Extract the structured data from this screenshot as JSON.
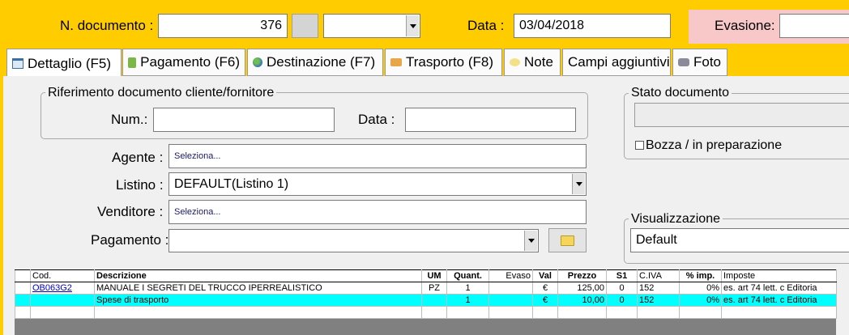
{
  "header": {
    "doc_number_label": "N. documento :",
    "doc_number_value": "376",
    "date_label": "Data :",
    "date_value": "03/04/2018",
    "evasione_label": "Evasione:"
  },
  "tabs": [
    {
      "label": "Dettaglio (F5)",
      "icon": "calendar-icon"
    },
    {
      "label": "Pagamento (F6)",
      "icon": "payment-icon"
    },
    {
      "label": "Destinazione (F7)",
      "icon": "globe-icon"
    },
    {
      "label": "Trasporto (F8)",
      "icon": "truck-icon"
    },
    {
      "label": "Note",
      "icon": "note-icon"
    },
    {
      "label": "Campi aggiuntivi",
      "icon": ""
    },
    {
      "label": "Foto",
      "icon": "camera-icon"
    }
  ],
  "riferimento": {
    "title": "Riferimento documento cliente/fornitore",
    "num_label": "Num.:",
    "data_label": "Data :"
  },
  "form": {
    "agente_label": "Agente :",
    "agente_value": "Seleziona...",
    "listino_label": "Listino :",
    "listino_value": "DEFAULT(Listino 1)",
    "venditore_label": "Venditore :",
    "venditore_value": "Seleziona...",
    "pagamento_label": "Pagamento :"
  },
  "stato": {
    "title": "Stato documento",
    "bozza_label": "Bozza / in preparazione"
  },
  "visualizzazione": {
    "title": "Visualizzazione",
    "value": "Default"
  },
  "table": {
    "columns": [
      "Cod.",
      "Descrizione",
      "UM",
      "Quant.",
      "Evaso",
      "Val",
      "Prezzo",
      "S1",
      "C.IVA",
      "% imp.",
      "Imposte"
    ],
    "rows": [
      [
        "OB063G2",
        "MANUALE I SEGRETI DEL TRUCCO IPERREALISTICO",
        "PZ",
        "1",
        "",
        "€",
        "125,00",
        "0",
        "152",
        "0%",
        "es. art 74 lett. c Editoria"
      ],
      [
        "",
        "Spese di trasporto",
        "",
        "1",
        "",
        "€",
        "10,00",
        "0",
        "152",
        "0%",
        "es. art 74 lett. c Editoria"
      ]
    ]
  }
}
